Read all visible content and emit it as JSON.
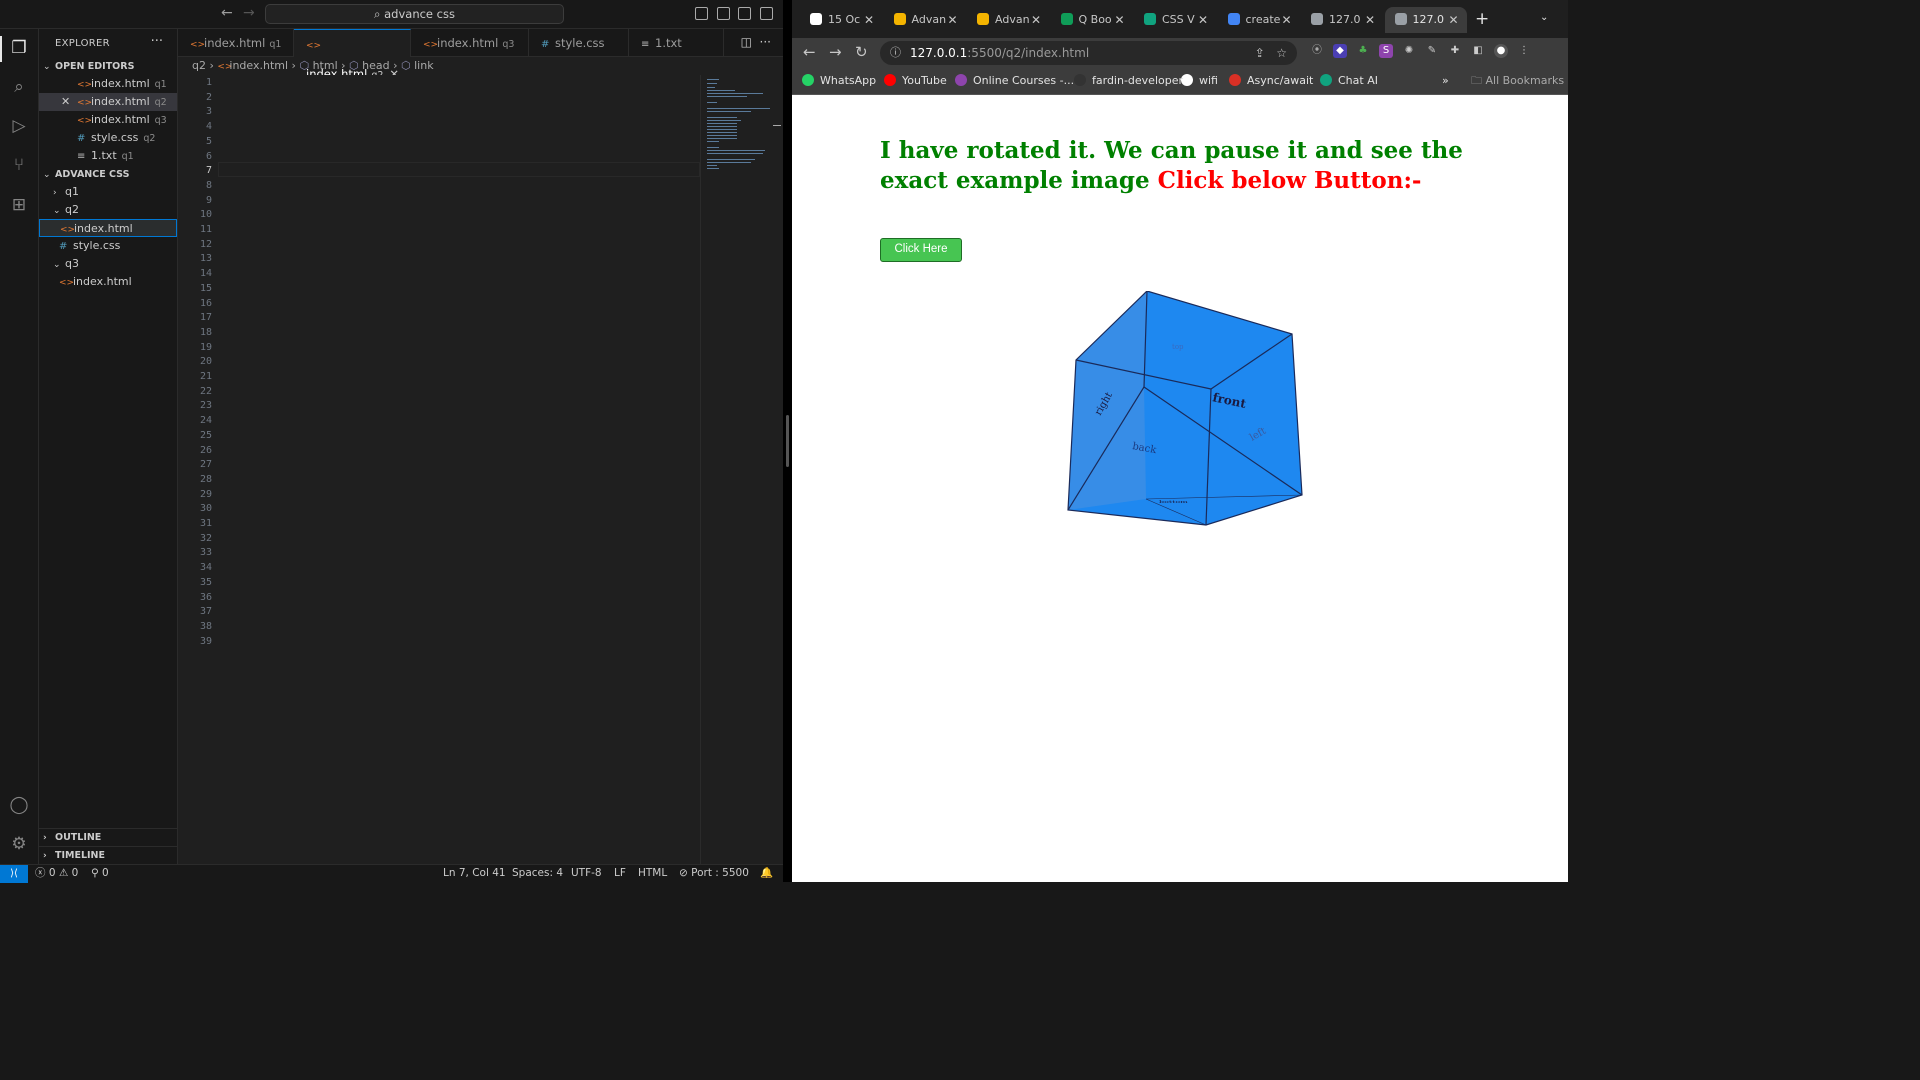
{
  "vscode": {
    "title": "advance css",
    "explorer_title": "EXPLORER",
    "open_editors_title": "OPEN EDITORS",
    "open_editors": [
      {
        "name": "index.html",
        "folder": "q1",
        "kind": "html"
      },
      {
        "name": "index.html",
        "folder": "q2",
        "kind": "html"
      },
      {
        "name": "index.html",
        "folder": "q3",
        "kind": "html"
      },
      {
        "name": "style.css",
        "folder": "q2",
        "kind": "css"
      },
      {
        "name": "1.txt",
        "folder": "q1",
        "kind": "txt"
      }
    ],
    "workspace_title": "ADVANCE CSS",
    "tree": {
      "q1": "q1",
      "q2": "q2",
      "q2_index": "index.html",
      "q2_style": "style.css",
      "q3": "q3",
      "q3_index": "index.html"
    },
    "outline_label": "OUTLINE",
    "timeline_label": "TIMELINE",
    "tabs": [
      {
        "name": "index.html",
        "folder": "q1"
      },
      {
        "name": "index.html",
        "folder": "q2"
      },
      {
        "name": "index.html",
        "folder": "q3"
      },
      {
        "name": "style.css",
        "folder": ""
      },
      {
        "name": "1.txt",
        "folder": ""
      }
    ],
    "breadcrumb": [
      "q2",
      "index.html",
      "html",
      "head",
      "link"
    ],
    "line_numbers": [
      "1",
      "2",
      "3",
      "4",
      "5",
      "6",
      "7",
      "8",
      "9",
      "10",
      "11",
      "12",
      "13",
      "14",
      "15",
      "16",
      "17",
      "18",
      "19",
      "20",
      "21",
      "22",
      "23",
      "24",
      "25",
      "26",
      "27",
      "28",
      "29",
      "30",
      "31",
      "32",
      "33",
      "34",
      "35",
      "36",
      "37",
      "38",
      "39"
    ],
    "status": {
      "errors": "0",
      "warnings": "0",
      "ports": "0",
      "position": "Ln 7, Col 41",
      "spaces": "Spaces: 4",
      "encoding": "UTF-8",
      "eol": "LF",
      "language": "HTML",
      "port": "Port : 5500"
    }
  },
  "browser": {
    "tabs": [
      {
        "label": "15 Oc",
        "fav": "#ffffff"
      },
      {
        "label": "Advan",
        "fav": "#f4b400"
      },
      {
        "label": "Advan",
        "fav": "#f4b400"
      },
      {
        "label": "Q Boo",
        "fav": "#0f9d58"
      },
      {
        "label": "CSS V",
        "fav": "#10a37f"
      },
      {
        "label": "create",
        "fav": "#4285f4"
      },
      {
        "label": "127.0",
        "fav": "#9aa0a6"
      },
      {
        "label": "127.0",
        "fav": "#9aa0a6"
      }
    ],
    "url_host": "127.0.0.1",
    "url_path": ":5500/q2/index.html",
    "bookmarks": [
      {
        "label": "WhatsApp",
        "color": "#25d366"
      },
      {
        "label": "YouTube",
        "color": "#ff0000"
      },
      {
        "label": "Online Courses -...",
        "color": "#8e44ad"
      },
      {
        "label": "fardin-developer",
        "color": "#333333"
      },
      {
        "label": "wifi",
        "color": "#ffffff"
      },
      {
        "label": "Async/await",
        "color": "#d93025"
      },
      {
        "label": "Chat AI",
        "color": "#10a37f"
      }
    ],
    "all_bookmarks": "All Bookmarks",
    "page": {
      "heading": "I have rotated it. We can pause it and see the exact example image ",
      "heading_red": "Click below Button:-",
      "button": "Click Here",
      "faces": {
        "front": "front",
        "back": "back",
        "left": "left",
        "right": "right",
        "top": "top",
        "bottom": "bottom"
      }
    }
  }
}
